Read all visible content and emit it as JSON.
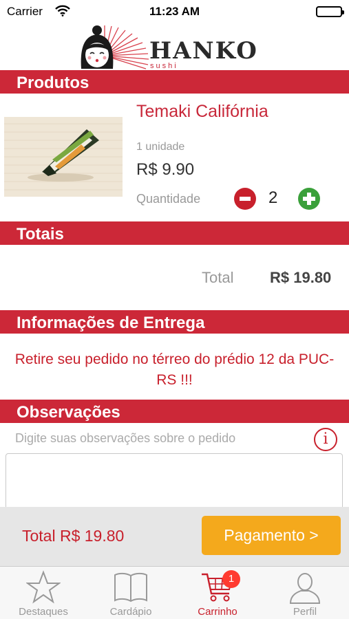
{
  "status_bar": {
    "carrier": "Carrier",
    "time": "11:23 AM"
  },
  "header": {
    "logo_text": "HANKO",
    "logo_sub": "sushi"
  },
  "sections": {
    "products": "Produtos",
    "totals": "Totais",
    "delivery": "Informações de Entrega",
    "observations": "Observações"
  },
  "product": {
    "name": "Temaki Califórnia",
    "unit": "1 unidade",
    "price": "R$ 9.90",
    "quantity_label": "Quantidade",
    "quantity": "2"
  },
  "totals": {
    "label": "Total",
    "value": "R$ 19.80"
  },
  "delivery": {
    "message": "Retire seu pedido no térreo do prédio 12 da PUC-RS !!!"
  },
  "observations": {
    "placeholder": "Digite suas observações sobre o pedido",
    "info": "i",
    "value": ""
  },
  "checkout": {
    "total": "Total R$ 19.80",
    "button": "Pagamento >"
  },
  "tabs": [
    {
      "label": "Destaques",
      "icon": "star-icon",
      "active": false
    },
    {
      "label": "Cardápio",
      "icon": "book-icon",
      "active": false
    },
    {
      "label": "Carrinho",
      "icon": "cart-icon",
      "active": true,
      "badge": "1"
    },
    {
      "label": "Perfil",
      "icon": "person-icon",
      "active": false
    }
  ],
  "colors": {
    "accent": "#cc2838",
    "pay": "#f4a91c",
    "minus": "#c8202c",
    "plus": "#3aa03a"
  }
}
